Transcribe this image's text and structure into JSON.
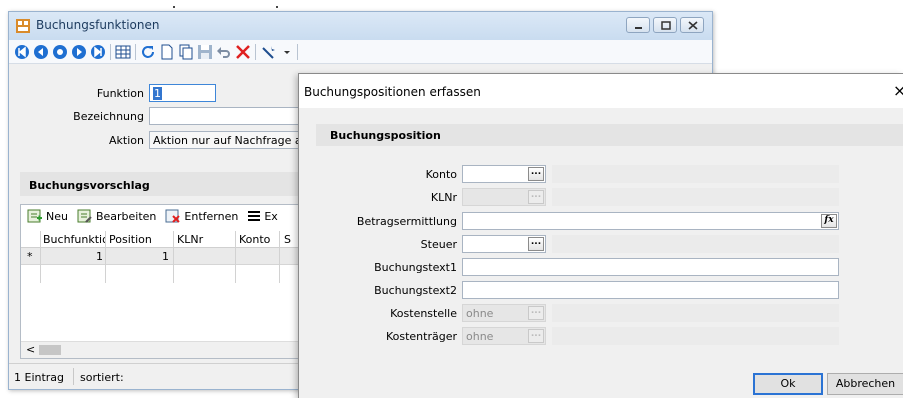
{
  "main_window": {
    "title": "Buchungsfunktionen",
    "fields": {
      "funktion_label": "Funktion",
      "funktion_value": "1",
      "bezeichnung_label": "Bezeichnung",
      "bezeichnung_value": "",
      "aktion_label": "Aktion",
      "aktion_value": "Aktion nur auf Nachfrage au"
    },
    "section_title": "Buchungsvorschlag",
    "grid": {
      "toolbar": {
        "neu": "Neu",
        "bearbeiten": "Bearbeiten",
        "entfernen": "Entfernen",
        "extra": "Ex"
      },
      "columns": [
        "Buchfunktio",
        "Position",
        "KLNr",
        "Konto",
        "S"
      ],
      "rows": [
        {
          "marker": "*",
          "buchfunktion": "1",
          "position": "1",
          "klnr": "",
          "konto": "",
          "s": ""
        }
      ],
      "scroll_left": "<"
    },
    "status": {
      "count": "1 Eintrag",
      "sorted_label": "sortiert:"
    }
  },
  "dialog": {
    "title": "Buchungspositionen erfassen",
    "close": "×",
    "section_title": "Buchungsposition",
    "fields": {
      "konto": "Konto",
      "klnr": "KLNr",
      "betragsermittlung": "Betragsermittlung",
      "steuer": "Steuer",
      "buchungstext1": "Buchungstext1",
      "buchungstext2": "Buchungstext2",
      "kostenstelle": "Kostenstelle",
      "kostenstelle_value": "ohne",
      "kostentraeger": "Kostenträger",
      "kostentraeger_value": "ohne",
      "dots": "...",
      "fx": "fx"
    },
    "buttons": {
      "ok": "Ok",
      "cancel": "Abbrechen"
    }
  },
  "colors": {
    "accent": "#2b73d4",
    "selection": "#3376cf",
    "title_text": "#1c3a5e"
  }
}
